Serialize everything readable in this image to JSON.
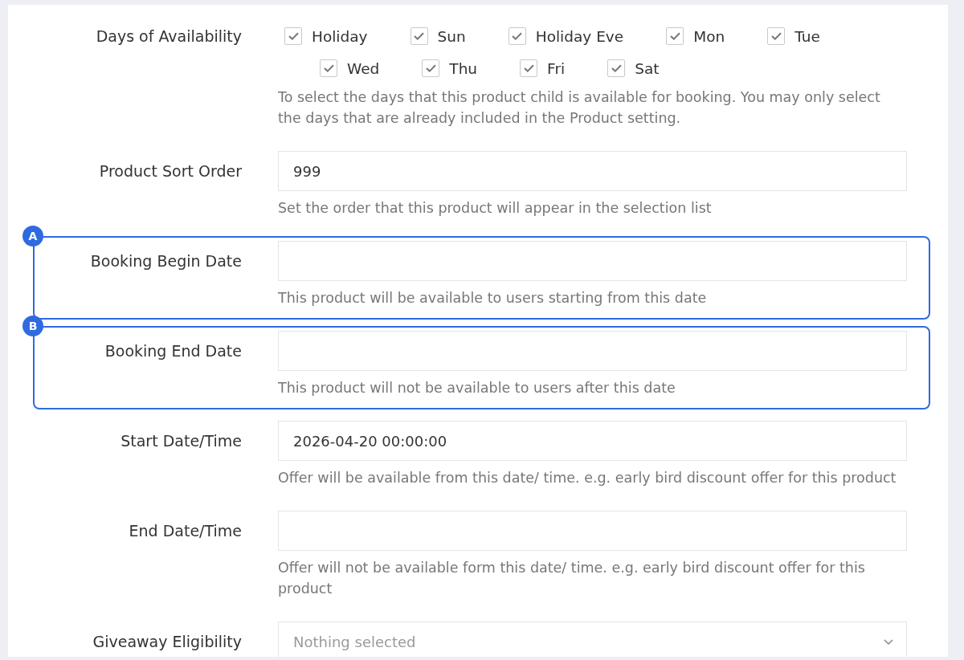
{
  "form": {
    "rows": [
      {
        "kind": "checkboxes",
        "label": "Days of Availability",
        "option_rows": [
          [
            {
              "label": "Holiday",
              "checked": true
            },
            {
              "label": "Sun",
              "checked": true
            },
            {
              "label": "Holiday Eve",
              "checked": true
            },
            {
              "label": "Mon",
              "checked": true
            },
            {
              "label": "Tue",
              "checked": true
            }
          ],
          [
            {
              "label": "Wed",
              "checked": true
            },
            {
              "label": "Thu",
              "checked": true
            },
            {
              "label": "Fri",
              "checked": true
            },
            {
              "label": "Sat",
              "checked": true
            }
          ]
        ],
        "help": "To select the days that this product child is available for booking. You may only select the days that are already included in the Product setting."
      },
      {
        "kind": "text",
        "label": "Product Sort Order",
        "value": "999",
        "help": "Set the order that this product will appear in the selection list"
      },
      {
        "kind": "text",
        "label": "Booking Begin Date",
        "help": "This product will be available to users starting from this date",
        "callout": "A"
      },
      {
        "kind": "text",
        "label": "Booking End Date",
        "help": "This product will not be available to users after this date",
        "callout": "B"
      },
      {
        "kind": "text",
        "label": "Start Date/Time",
        "value": "2026-04-20 00:00:00",
        "help": "Offer will be available from this date/ time. e.g. early bird discount offer for this product"
      },
      {
        "kind": "text",
        "label": "End Date/Time",
        "help": "Offer will not be available form this date/ time. e.g. early bird discount offer for this product"
      },
      {
        "kind": "select",
        "label": "Giveaway Eligibility",
        "placeholder": "Nothing selected"
      }
    ]
  }
}
